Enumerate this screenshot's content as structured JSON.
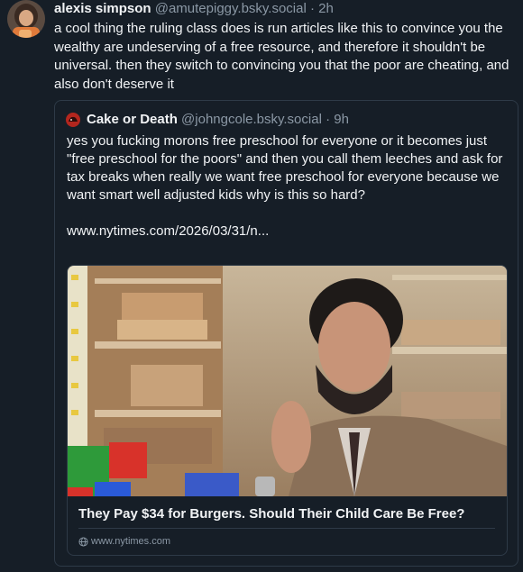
{
  "post": {
    "author_name": "alexis simpson",
    "author_handle": "@amutepiggy.bsky.social",
    "separator": "·",
    "time": "2h",
    "text": "a cool thing the ruling class does is  run articles like this to convince you the wealthy are undeserving of a free resource, and therefore it shouldn't be universal. then they switch to convincing you that the poor are cheating, and also don't deserve it"
  },
  "quote": {
    "author_name": "Cake or Death",
    "author_handle": "@johngcole.bsky.social",
    "separator": "·",
    "time": "9h",
    "text": "yes you fucking morons free preschool for everyone or it becomes just \"free preschool for the poors\" and then you call them leeches and ask for tax breaks when really we want free preschool for everyone because we want smart well adjusted kids why is this so hard?\n\nwww.nytimes.com/2026/03/31/n...",
    "card": {
      "title": "They Pay $34 for Burgers. Should Their Child Care Be Free?",
      "domain": "www.nytimes.com"
    }
  },
  "icons": {
    "avatar": "user-avatar",
    "quote_avatar": "cake-avatar-icon",
    "globe": "globe-icon"
  },
  "colors": {
    "background": "#161e27",
    "text": "#f1f3f5",
    "muted": "#8b98a5",
    "border": "#2e3a47"
  }
}
